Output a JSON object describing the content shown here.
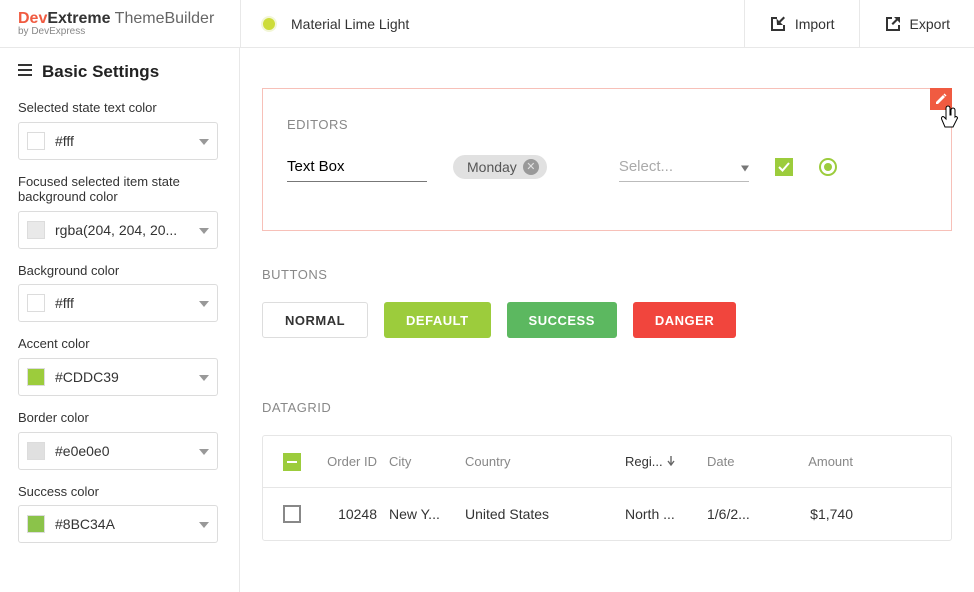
{
  "brand": {
    "prefix": "Dev",
    "suffix": "Extreme",
    "product": " ThemeBuilder",
    "byline": "by DevExpress"
  },
  "header": {
    "theme": "Material Lime Light",
    "import": "Import",
    "export": "Export"
  },
  "sidebar": {
    "title": "Basic Settings",
    "fields": [
      {
        "label": "Selected state text color",
        "value": "#fff",
        "swatch": "#ffffff"
      },
      {
        "label": "Focused selected item state background color",
        "value": "rgba(204, 204, 20...",
        "swatch": "#e9e9e9"
      },
      {
        "label": "Background color",
        "value": "#fff",
        "swatch": "#ffffff"
      },
      {
        "label": "Accent color",
        "value": "#CDDC39",
        "swatch": "#9ccc3c"
      },
      {
        "label": "Border color",
        "value": "#e0e0e0",
        "swatch": "#e0e0e0"
      },
      {
        "label": "Success color",
        "value": "#8BC34A",
        "swatch": "#8bc34a"
      }
    ]
  },
  "editors": {
    "title": "EDITORS",
    "textbox_value": "Text Box",
    "chip_label": "Monday",
    "select_placeholder": "Select..."
  },
  "buttons": {
    "title": "BUTTONS",
    "normal": "NORMAL",
    "default": "DEFAULT",
    "success": "SUCCESS",
    "danger": "DANGER"
  },
  "datagrid": {
    "title": "DATAGRID",
    "columns": {
      "order": "Order ID",
      "city": "City",
      "country": "Country",
      "region": "Regi...",
      "date": "Date",
      "amount": "Amount"
    },
    "rows": [
      {
        "order": "10248",
        "city": "New Y...",
        "country": "United States",
        "region": "North ...",
        "date": "1/6/2...",
        "amount": "$1,740"
      }
    ]
  }
}
